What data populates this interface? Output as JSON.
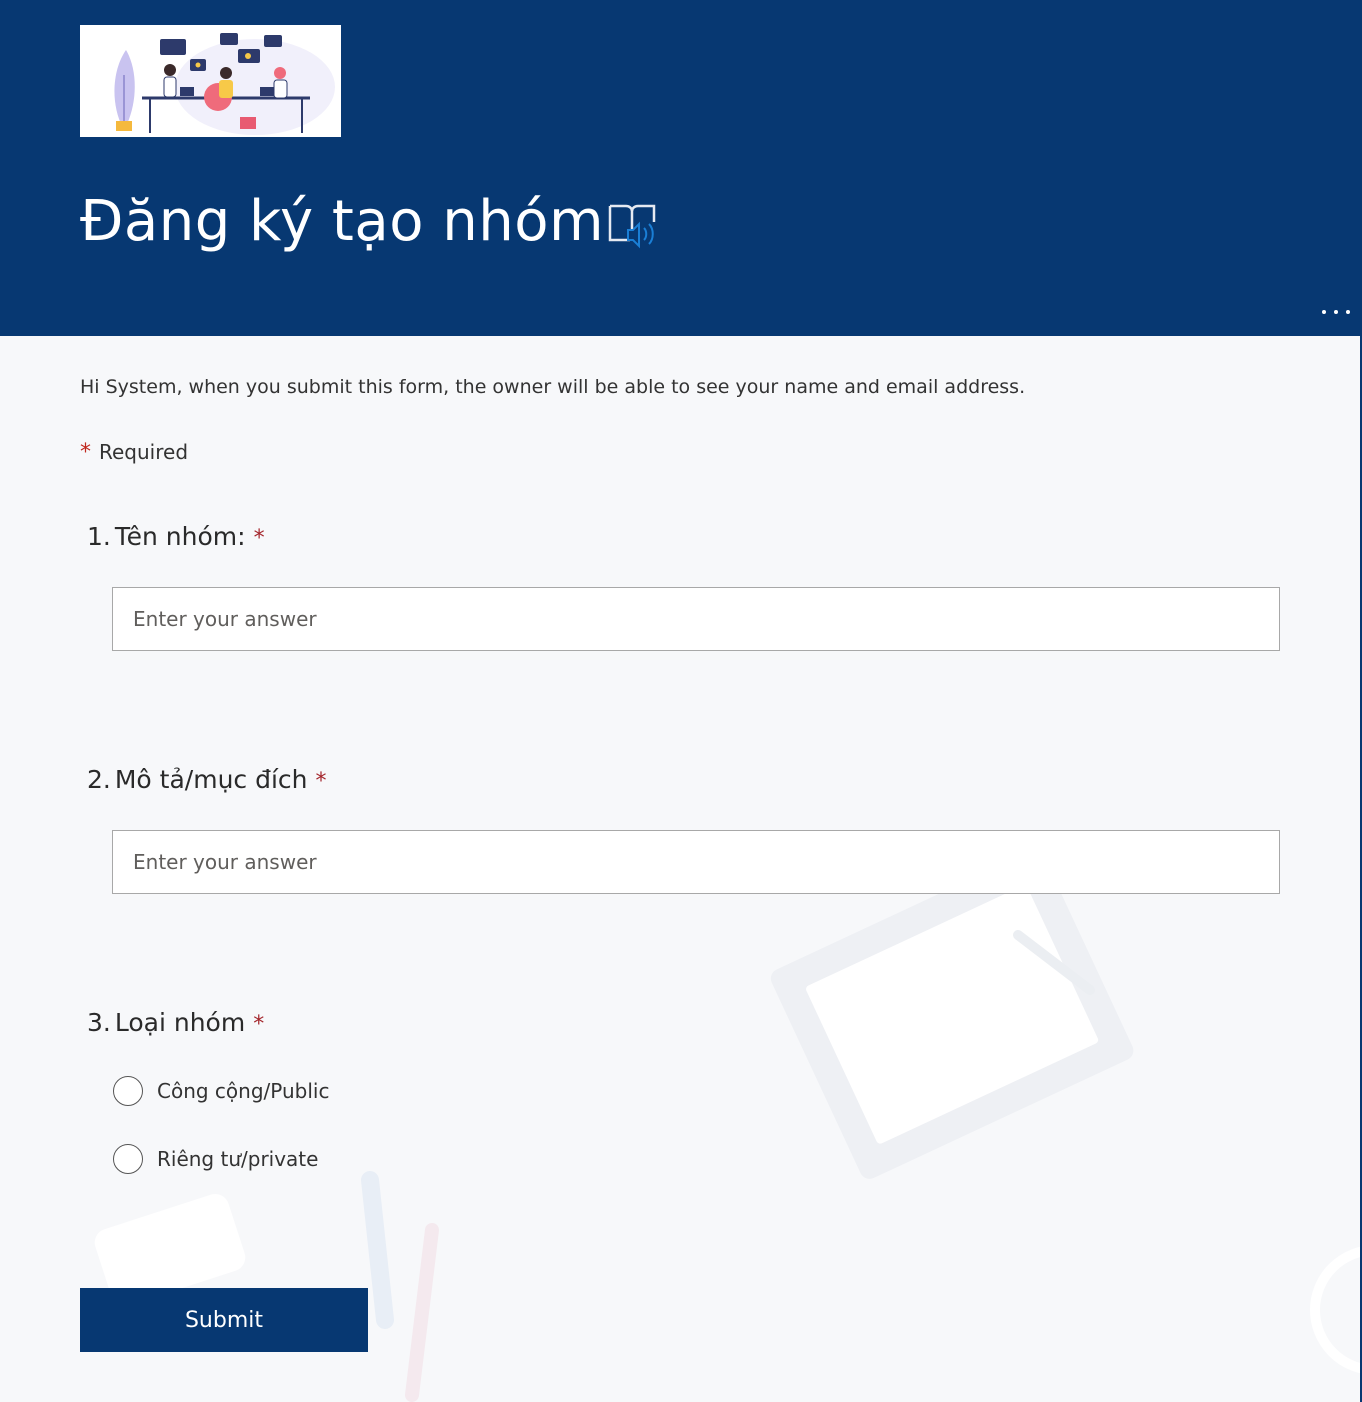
{
  "form": {
    "title": "Đăng ký tạo nhóm",
    "notice": "Hi System, when you submit this form, the owner will be able to see your name and email address.",
    "required_star": "*",
    "required_label": "Required"
  },
  "questions": [
    {
      "number": "1.",
      "label": "Tên nhóm:",
      "star": "*",
      "placeholder": "Enter your answer"
    },
    {
      "number": "2.",
      "label": "Mô tả/mục đích",
      "star": "*",
      "placeholder": "Enter your answer"
    },
    {
      "number": "3.",
      "label": "Loại nhóm",
      "star": "*",
      "options": [
        "Công cộng/Public",
        "Riêng tư/private"
      ]
    }
  ],
  "actions": {
    "submit_label": "Submit"
  },
  "icons": {
    "reader": "immersive-reader-icon",
    "more": "more-options-icon"
  },
  "colors": {
    "header": "#073872",
    "required": "#a4262c",
    "reader_accent": "#1a7fd6"
  }
}
